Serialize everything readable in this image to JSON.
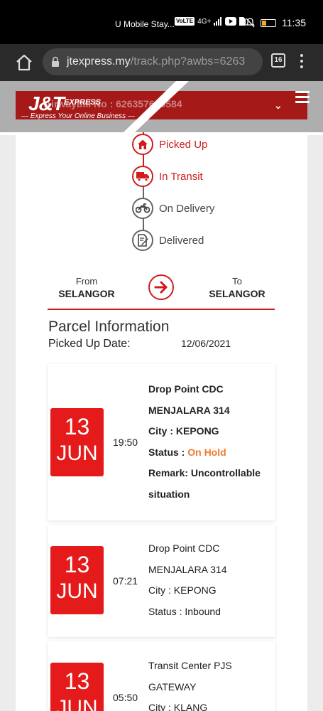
{
  "status_bar": {
    "carrier": "U Mobile Stay...",
    "volte": "VoLTE",
    "network": "4G+",
    "time": "11:35"
  },
  "browser": {
    "url_host": "jtexpress.my",
    "url_path": "/track.php?awbs=6263",
    "tab_count": "16"
  },
  "header": {
    "logo_main": "J&T",
    "logo_sub": "EXPRESS",
    "logo_tagline": "— Express Your Online Business —",
    "awb_text": "Airwaybill No : 626357649584"
  },
  "tracking_steps": [
    {
      "label": "Picked Up",
      "icon": "home-icon",
      "active": true
    },
    {
      "label": "In Transit",
      "icon": "truck-icon",
      "active": true
    },
    {
      "label": "On Delivery",
      "icon": "motorcycle-icon",
      "active": false
    },
    {
      "label": "Delivered",
      "icon": "signed-document-icon",
      "active": false
    }
  ],
  "route": {
    "from_label": "From",
    "from_value": "SELANGOR",
    "to_label": "To",
    "to_value": "SELANGOR"
  },
  "parcel": {
    "title": "Parcel Information",
    "picked_label": "Picked Up Date:",
    "picked_value": "12/06/2021"
  },
  "events": [
    {
      "day": "13",
      "month": "JUN",
      "time": "19:50",
      "place_line1": "Drop Point CDC",
      "place_line2": "MENJALARA 314",
      "city": "City : KEPONG",
      "status_label": "Status : ",
      "status_value": "On Hold",
      "remark_line1": "Remark: Uncontrollable",
      "remark_line2": "situation"
    },
    {
      "day": "13",
      "month": "JUN",
      "time": "07:21",
      "place_line1": "Drop Point CDC",
      "place_line2": "MENJALARA 314",
      "city": "City : KEPONG",
      "status": "Status : Inbound"
    },
    {
      "day": "13",
      "month": "JUN",
      "time": "05:50",
      "place_line1": "Transit Center PJS",
      "place_line2": "GATEWAY",
      "city": "City : KLANG"
    }
  ],
  "colors": {
    "brand_red": "#d01c1c",
    "date_red": "#e51b1b",
    "status_orange": "#f07a2a"
  }
}
